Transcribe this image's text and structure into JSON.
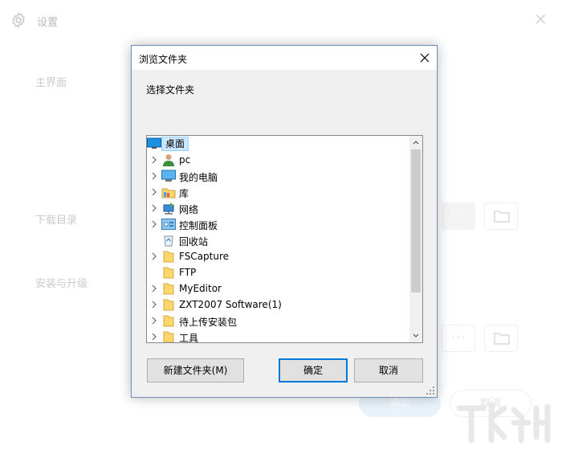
{
  "background": {
    "window_title": "设置",
    "section_main": "主界面",
    "section_download": "下载目录",
    "section_install": "安装与升级",
    "more_glyph": "···",
    "ok_label": "确定",
    "cancel_label": "取消",
    "close_glyph": "✕"
  },
  "dialog": {
    "title": "浏览文件夹",
    "description": "选择文件夹",
    "tree": {
      "root": {
        "label": "桌面",
        "icon": "desktop-icon"
      },
      "items": [
        {
          "label": "pc",
          "icon": "user-icon",
          "expandable": true
        },
        {
          "label": "我的电脑",
          "icon": "computer-icon",
          "expandable": true
        },
        {
          "label": "库",
          "icon": "library-icon",
          "expandable": true
        },
        {
          "label": "网络",
          "icon": "network-icon",
          "expandable": true
        },
        {
          "label": "控制面板",
          "icon": "control-panel-icon",
          "expandable": true
        },
        {
          "label": "回收站",
          "icon": "recycle-bin-icon",
          "expandable": false
        },
        {
          "label": "FSCapture",
          "icon": "folder-icon",
          "expandable": true
        },
        {
          "label": "FTP",
          "icon": "folder-icon",
          "expandable": false
        },
        {
          "label": "MyEditor",
          "icon": "folder-icon",
          "expandable": true
        },
        {
          "label": "ZXT2007 Software(1)",
          "icon": "folder-icon",
          "expandable": true
        },
        {
          "label": "待上传安装包",
          "icon": "folder-icon",
          "expandable": true
        },
        {
          "label": "工具",
          "icon": "folder-icon",
          "expandable": true
        }
      ]
    },
    "buttons": {
      "new_folder": "新建文件夹(M)",
      "ok": "确定",
      "cancel": "取消"
    }
  },
  "colors": {
    "selection_fill": "#cce8ff",
    "default_button_border": "#0078d7",
    "folder_yellow": "#ffd66b"
  }
}
